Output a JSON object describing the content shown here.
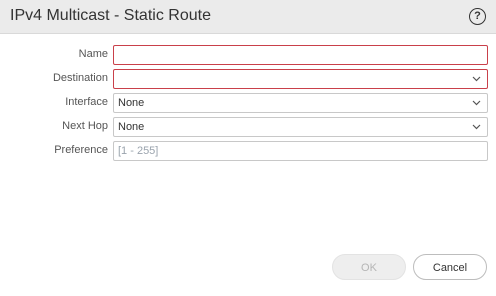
{
  "dialog": {
    "title": "IPv4 Multicast - Static Route",
    "help_glyph": "?"
  },
  "form": {
    "name": {
      "label": "Name",
      "value": ""
    },
    "destination": {
      "label": "Destination",
      "value": ""
    },
    "interface": {
      "label": "Interface",
      "value": "None"
    },
    "next_hop": {
      "label": "Next Hop",
      "value": "None"
    },
    "preference": {
      "label": "Preference",
      "placeholder": "[1 - 255]"
    }
  },
  "buttons": {
    "ok": "OK",
    "cancel": "Cancel"
  },
  "colors": {
    "invalid_border": "#c9404a",
    "titlebar_bg": "#ebebeb"
  },
  "icons": {
    "help": "help-icon",
    "dropdown": "chevron-down-icon"
  }
}
